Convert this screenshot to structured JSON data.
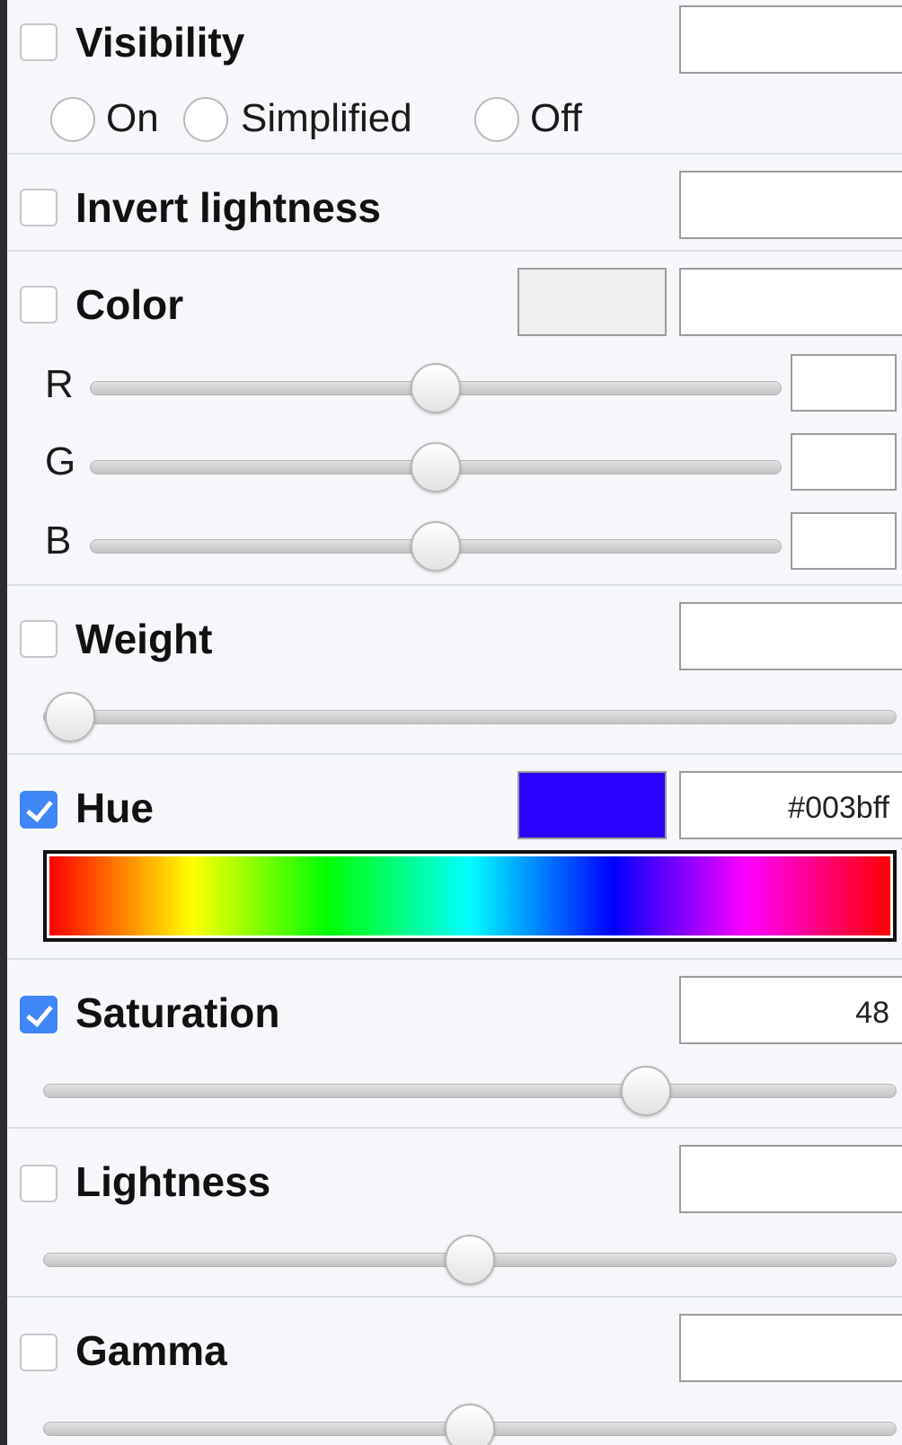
{
  "visibility": {
    "label": "Visibility",
    "checked": false,
    "value": "",
    "options": [
      "On",
      "Simplified",
      "Off"
    ]
  },
  "invert_lightness": {
    "label": "Invert lightness",
    "checked": false,
    "value": ""
  },
  "color": {
    "label": "Color",
    "checked": false,
    "value": "",
    "swatch_color": "#efefef",
    "channels": [
      {
        "letter": "R",
        "value": "",
        "level": 0.5
      },
      {
        "letter": "G",
        "value": "",
        "level": 0.5
      },
      {
        "letter": "B",
        "value": "",
        "level": 0.5
      }
    ]
  },
  "weight": {
    "label": "Weight",
    "checked": false,
    "value": "",
    "level": 0.0
  },
  "hue": {
    "label": "Hue",
    "checked": true,
    "value": "#003bff",
    "swatch_color": "#2a00ff"
  },
  "saturation": {
    "label": "Saturation",
    "checked": true,
    "value": "48",
    "level": 0.72
  },
  "lightness": {
    "label": "Lightness",
    "checked": false,
    "value": "",
    "level": 0.5
  },
  "gamma": {
    "label": "Gamma",
    "checked": false,
    "value": "",
    "level": 0.5
  },
  "colors": {
    "panel_background": "#f6f7fb",
    "checkbox_checked": "#3f86f7"
  }
}
